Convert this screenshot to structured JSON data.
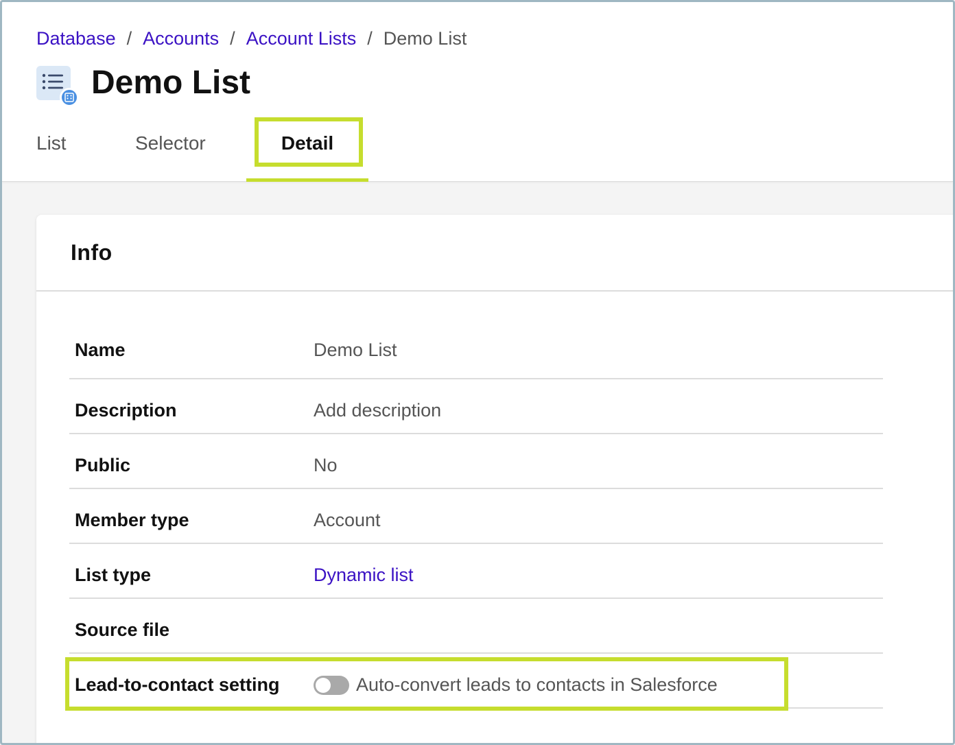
{
  "breadcrumb": {
    "items": [
      "Database",
      "Accounts",
      "Account Lists"
    ],
    "current": "Demo List",
    "separator": "/"
  },
  "page": {
    "title": "Demo List",
    "icon": "list-icon"
  },
  "tabs": [
    {
      "label": "List",
      "active": false
    },
    {
      "label": "Selector",
      "active": false
    },
    {
      "label": "Detail",
      "active": true
    }
  ],
  "card": {
    "title": "Info",
    "rows": [
      {
        "label": "Name",
        "value": "Demo List"
      },
      {
        "label": "Description",
        "value": "Add description"
      },
      {
        "label": "Public",
        "value": "No"
      },
      {
        "label": "Member type",
        "value": "Account"
      },
      {
        "label": "List type",
        "value": "Dynamic list"
      },
      {
        "label": "Source file",
        "value": ""
      },
      {
        "label": "Lead-to-contact setting",
        "toggle_label": "Auto-convert leads to contacts in Salesforce",
        "toggle_on": false
      }
    ]
  },
  "colors": {
    "link": "#3b12c4",
    "highlight": "#c6dd2e",
    "toggle_off": "#a9a9a9"
  }
}
